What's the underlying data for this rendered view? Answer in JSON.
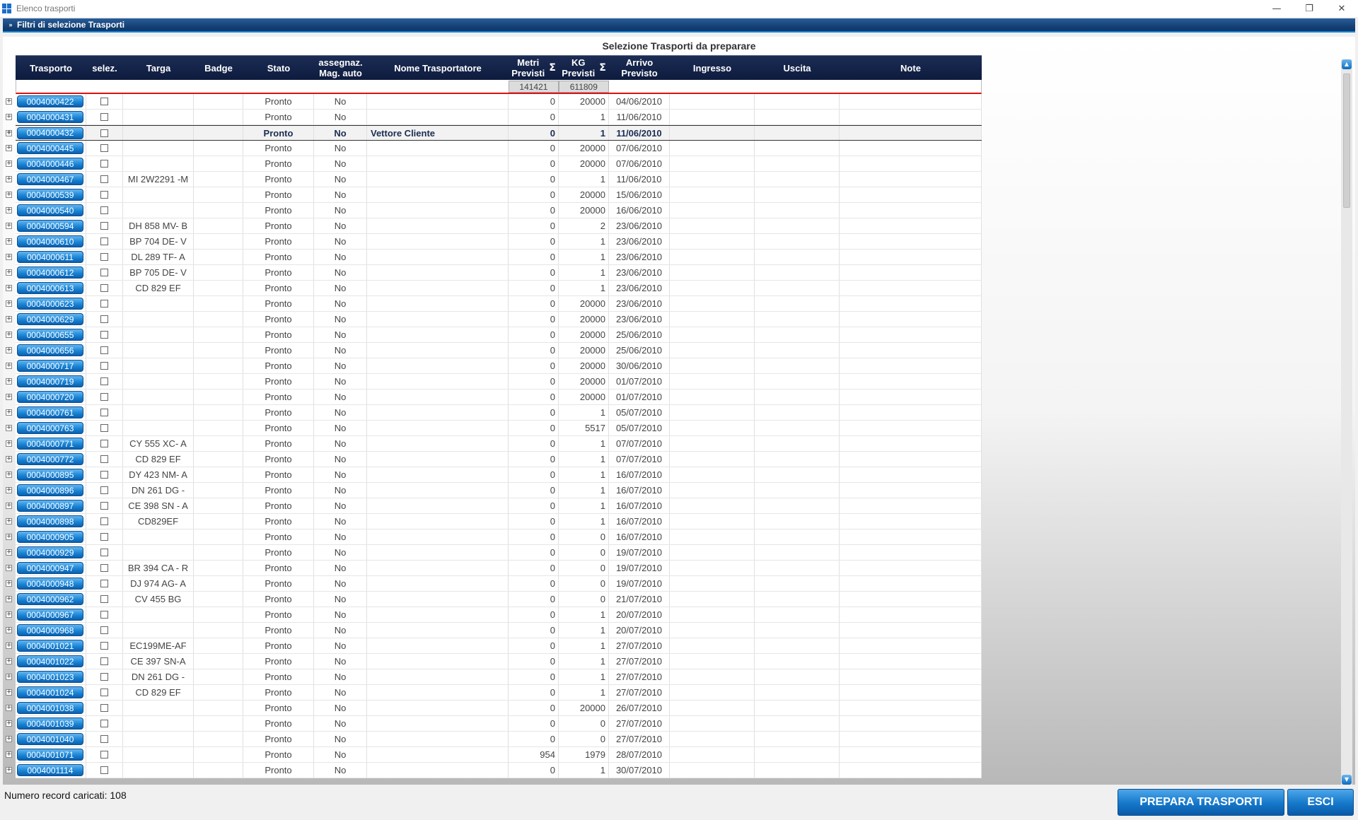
{
  "window": {
    "title": "Elenco trasporti",
    "controls": {
      "minimize": "—",
      "restore": "❐",
      "close": "✕"
    }
  },
  "filters": {
    "label": "Filtri di selezione Trasporti",
    "chevron": "»"
  },
  "section_title": "Selezione Trasporti da preparare",
  "columns": [
    {
      "key": "trasporto",
      "label": "Trasporto"
    },
    {
      "key": "selez",
      "label": "selez."
    },
    {
      "key": "targa",
      "label": "Targa"
    },
    {
      "key": "badge",
      "label": "Badge"
    },
    {
      "key": "stato",
      "label": "Stato"
    },
    {
      "key": "assegnaz",
      "label": "assegnaz.\nMag. auto"
    },
    {
      "key": "nome",
      "label": "Nome Trasportatore"
    },
    {
      "key": "metri",
      "label": "Metri\nPrevisti",
      "sigma": "Σ"
    },
    {
      "key": "kg",
      "label": "KG\nPrevisti",
      "sigma": "Σ"
    },
    {
      "key": "arrivo",
      "label": "Arrivo\nPrevisto"
    },
    {
      "key": "ingresso",
      "label": "Ingresso"
    },
    {
      "key": "uscita",
      "label": "Uscita"
    },
    {
      "key": "note",
      "label": "Note"
    }
  ],
  "totals": {
    "metri": "141421",
    "kg": "611809"
  },
  "rows": [
    [
      "0004000422",
      "",
      "Pronto",
      "No",
      "",
      "0",
      "20000",
      "04/06/2010"
    ],
    [
      "0004000431",
      "",
      "Pronto",
      "No",
      "",
      "0",
      "1",
      "11/06/2010"
    ],
    [
      "0004000432",
      "",
      "Pronto",
      "No",
      "Vettore Cliente",
      "0",
      "1",
      "11/06/2010"
    ],
    [
      "0004000445",
      "",
      "Pronto",
      "No",
      "",
      "0",
      "20000",
      "07/06/2010"
    ],
    [
      "0004000446",
      "",
      "Pronto",
      "No",
      "",
      "0",
      "20000",
      "07/06/2010"
    ],
    [
      "0004000467",
      "MI 2W2291 -M",
      "Pronto",
      "No",
      "",
      "0",
      "1",
      "11/06/2010"
    ],
    [
      "0004000539",
      "",
      "Pronto",
      "No",
      "",
      "0",
      "20000",
      "15/06/2010"
    ],
    [
      "0004000540",
      "",
      "Pronto",
      "No",
      "",
      "0",
      "20000",
      "16/06/2010"
    ],
    [
      "0004000594",
      "DH 858 MV- B",
      "Pronto",
      "No",
      "",
      "0",
      "2",
      "23/06/2010"
    ],
    [
      "0004000610",
      "BP 704 DE- V",
      "Pronto",
      "No",
      "",
      "0",
      "1",
      "23/06/2010"
    ],
    [
      "0004000611",
      "DL 289 TF- A",
      "Pronto",
      "No",
      "",
      "0",
      "1",
      "23/06/2010"
    ],
    [
      "0004000612",
      "BP 705 DE- V",
      "Pronto",
      "No",
      "",
      "0",
      "1",
      "23/06/2010"
    ],
    [
      "0004000613",
      "CD 829 EF",
      "Pronto",
      "No",
      "",
      "0",
      "1",
      "23/06/2010"
    ],
    [
      "0004000623",
      "",
      "Pronto",
      "No",
      "",
      "0",
      "20000",
      "23/06/2010"
    ],
    [
      "0004000629",
      "",
      "Pronto",
      "No",
      "",
      "0",
      "20000",
      "23/06/2010"
    ],
    [
      "0004000655",
      "",
      "Pronto",
      "No",
      "",
      "0",
      "20000",
      "25/06/2010"
    ],
    [
      "0004000656",
      "",
      "Pronto",
      "No",
      "",
      "0",
      "20000",
      "25/06/2010"
    ],
    [
      "0004000717",
      "",
      "Pronto",
      "No",
      "",
      "0",
      "20000",
      "30/06/2010"
    ],
    [
      "0004000719",
      "",
      "Pronto",
      "No",
      "",
      "0",
      "20000",
      "01/07/2010"
    ],
    [
      "0004000720",
      "",
      "Pronto",
      "No",
      "",
      "0",
      "20000",
      "01/07/2010"
    ],
    [
      "0004000761",
      "",
      "Pronto",
      "No",
      "",
      "0",
      "1",
      "05/07/2010"
    ],
    [
      "0004000763",
      "",
      "Pronto",
      "No",
      "",
      "0",
      "5517",
      "05/07/2010"
    ],
    [
      "0004000771",
      "CY 555 XC- A",
      "Pronto",
      "No",
      "",
      "0",
      "1",
      "07/07/2010"
    ],
    [
      "0004000772",
      "CD 829 EF",
      "Pronto",
      "No",
      "",
      "0",
      "1",
      "07/07/2010"
    ],
    [
      "0004000895",
      "DY 423 NM- A",
      "Pronto",
      "No",
      "",
      "0",
      "1",
      "16/07/2010"
    ],
    [
      "0004000896",
      "DN 261 DG -",
      "Pronto",
      "No",
      "",
      "0",
      "1",
      "16/07/2010"
    ],
    [
      "0004000897",
      "CE 398 SN - A",
      "Pronto",
      "No",
      "",
      "0",
      "1",
      "16/07/2010"
    ],
    [
      "0004000898",
      "CD829EF",
      "Pronto",
      "No",
      "",
      "0",
      "1",
      "16/07/2010"
    ],
    [
      "0004000905",
      "",
      "Pronto",
      "No",
      "",
      "0",
      "0",
      "16/07/2010"
    ],
    [
      "0004000929",
      "",
      "Pronto",
      "No",
      "",
      "0",
      "0",
      "19/07/2010"
    ],
    [
      "0004000947",
      "BR 394 CA - R",
      "Pronto",
      "No",
      "",
      "0",
      "0",
      "19/07/2010"
    ],
    [
      "0004000948",
      "DJ 974 AG- A",
      "Pronto",
      "No",
      "",
      "0",
      "0",
      "19/07/2010"
    ],
    [
      "0004000962",
      "CV 455 BG",
      "Pronto",
      "No",
      "",
      "0",
      "0",
      "21/07/2010"
    ],
    [
      "0004000967",
      "",
      "Pronto",
      "No",
      "",
      "0",
      "1",
      "20/07/2010"
    ],
    [
      "0004000968",
      "",
      "Pronto",
      "No",
      "",
      "0",
      "1",
      "20/07/2010"
    ],
    [
      "0004001021",
      "EC199ME-AF",
      "Pronto",
      "No",
      "",
      "0",
      "1",
      "27/07/2010"
    ],
    [
      "0004001022",
      "CE 397 SN-A",
      "Pronto",
      "No",
      "",
      "0",
      "1",
      "27/07/2010"
    ],
    [
      "0004001023",
      "DN 261 DG -",
      "Pronto",
      "No",
      "",
      "0",
      "1",
      "27/07/2010"
    ],
    [
      "0004001024",
      "CD 829 EF",
      "Pronto",
      "No",
      "",
      "0",
      "1",
      "27/07/2010"
    ],
    [
      "0004001038",
      "",
      "Pronto",
      "No",
      "",
      "0",
      "20000",
      "26/07/2010"
    ],
    [
      "0004001039",
      "",
      "Pronto",
      "No",
      "",
      "0",
      "0",
      "27/07/2010"
    ],
    [
      "0004001040",
      "",
      "Pronto",
      "No",
      "",
      "0",
      "0",
      "27/07/2010"
    ],
    [
      "0004001071",
      "",
      "Pronto",
      "No",
      "",
      "954",
      "1979",
      "28/07/2010"
    ],
    [
      "0004001114",
      "",
      "Pronto",
      "No",
      "",
      "0",
      "1",
      "30/07/2010"
    ]
  ],
  "selected_row_index": 2,
  "footer": {
    "records_label": "Numero record caricati: 108",
    "prepare_button": "PREPARA TRASPORTI",
    "exit_button": "ESCI"
  },
  "colors": {
    "accent": "#1a85d6",
    "header_bg": "#0d1b3e",
    "totals_line": "#dd1111"
  }
}
